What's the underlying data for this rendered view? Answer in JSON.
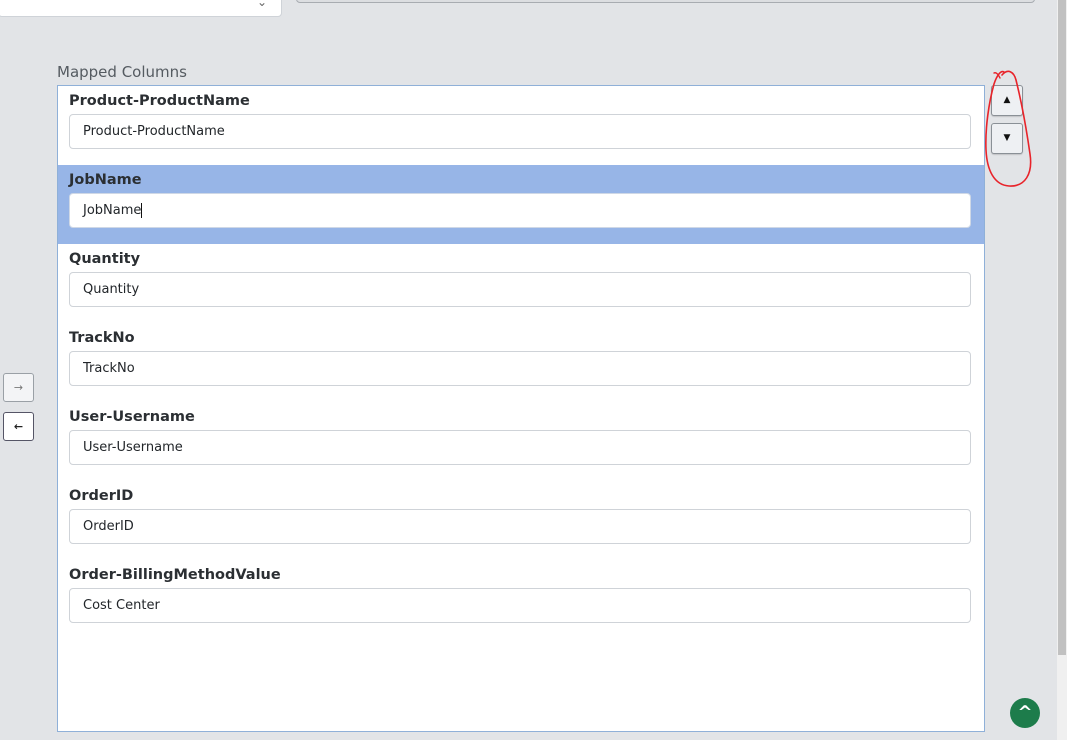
{
  "section_label": "Mapped Columns",
  "mapped_columns": [
    {
      "label": "Product-ProductName",
      "value": "Product-ProductName",
      "selected": false
    },
    {
      "label": "JobName",
      "value": "JobName",
      "selected": true
    },
    {
      "label": "Quantity",
      "value": "Quantity",
      "selected": false
    },
    {
      "label": "TrackNo",
      "value": "TrackNo",
      "selected": false
    },
    {
      "label": "User-Username",
      "value": "User-Username",
      "selected": false
    },
    {
      "label": "OrderID",
      "value": "OrderID",
      "selected": false
    },
    {
      "label": "Order-BillingMethodValue",
      "value": "Cost Center",
      "selected": false
    }
  ],
  "icons": {
    "move_right": "→",
    "move_left": "←",
    "move_up": "▲",
    "move_down": "▼",
    "scroll_top": "^",
    "dropdown": "⌄"
  },
  "colors": {
    "selected_row": "#97b5e7",
    "list_border": "#8fb0d8",
    "annotation": "#e8232a",
    "scroll_top_button": "#1d7c4b"
  }
}
